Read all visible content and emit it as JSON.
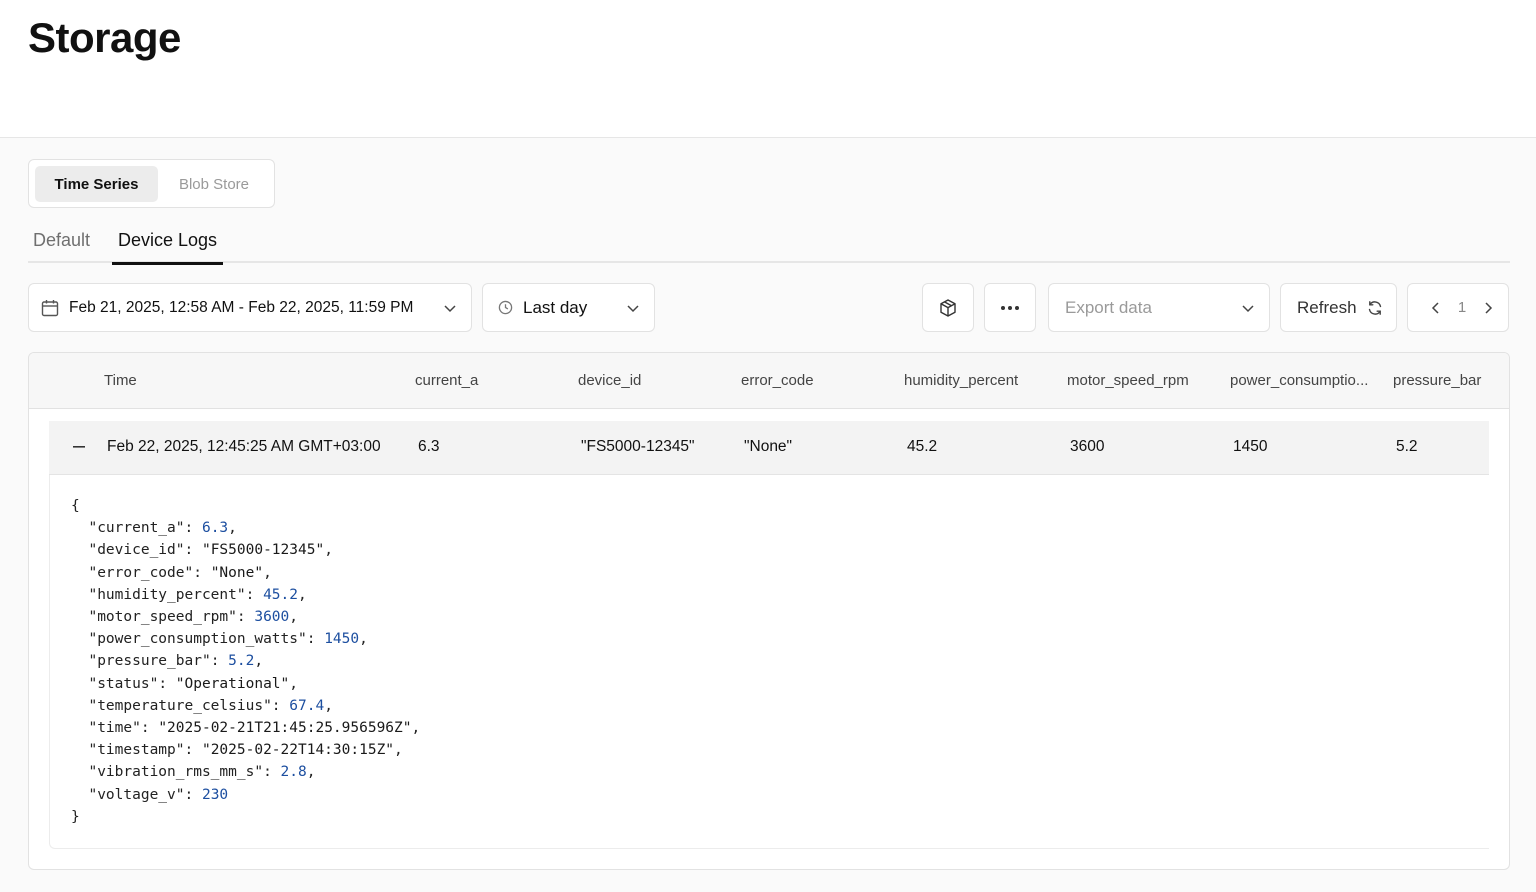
{
  "page": {
    "title": "Storage"
  },
  "segmented": {
    "active": "Time Series",
    "inactive": "Blob Store"
  },
  "tabs": [
    {
      "label": "Default"
    },
    {
      "label": "Device Logs"
    }
  ],
  "toolbar": {
    "date_range": "Feb 21, 2025, 12:58 AM - Feb 22, 2025, 11:59 PM",
    "quick_range": "Last day",
    "export_placeholder": "Export data",
    "refresh_label": "Refresh",
    "page_number": "1"
  },
  "table": {
    "columns": [
      "Time",
      "current_a",
      "device_id",
      "error_code",
      "humidity_percent",
      "motor_speed_rpm",
      "power_consumptio...",
      "pressure_bar"
    ],
    "row": {
      "time": "Feb 22, 2025, 12:45:25 AM GMT+03:00",
      "current_a": "6.3",
      "device_id": "\"FS5000-12345\"",
      "error_code": "\"None\"",
      "humidity_percent": "45.2",
      "motor_speed_rpm": "3600",
      "power_consumption": "1450",
      "pressure_bar": "5.2"
    }
  },
  "json_detail": {
    "open": "{",
    "close": "}",
    "lines": [
      {
        "key": "\"current_a\"",
        "value": "6.3",
        "type": "number"
      },
      {
        "key": "\"device_id\"",
        "value": "\"FS5000-12345\"",
        "type": "string"
      },
      {
        "key": "\"error_code\"",
        "value": "\"None\"",
        "type": "string"
      },
      {
        "key": "\"humidity_percent\"",
        "value": "45.2",
        "type": "number"
      },
      {
        "key": "\"motor_speed_rpm\"",
        "value": "3600",
        "type": "number"
      },
      {
        "key": "\"power_consumption_watts\"",
        "value": "1450",
        "type": "number"
      },
      {
        "key": "\"pressure_bar\"",
        "value": "5.2",
        "type": "number"
      },
      {
        "key": "\"status\"",
        "value": "\"Operational\"",
        "type": "string"
      },
      {
        "key": "\"temperature_celsius\"",
        "value": "67.4",
        "type": "number"
      },
      {
        "key": "\"time\"",
        "value": "\"2025-02-21T21:45:25.956596Z\"",
        "type": "string"
      },
      {
        "key": "\"timestamp\"",
        "value": "\"2025-02-22T14:30:15Z\"",
        "type": "string"
      },
      {
        "key": "\"vibration_rms_mm_s\"",
        "value": "2.8",
        "type": "number"
      },
      {
        "key": "\"voltage_v\"",
        "value": "230",
        "type": "number"
      }
    ]
  },
  "icons": {
    "calendar": "calendar-icon",
    "clock": "clock-icon",
    "chevron": "chevron-down-icon",
    "cube": "cube-icon",
    "more": "more-horizontal-icon",
    "refresh": "refresh-icon",
    "prev": "chevron-left-icon",
    "next": "chevron-right-icon",
    "collapse": "minus-icon"
  },
  "colors": {
    "json_number": "#1d4fa0",
    "active_tab_underline": "#111111"
  }
}
